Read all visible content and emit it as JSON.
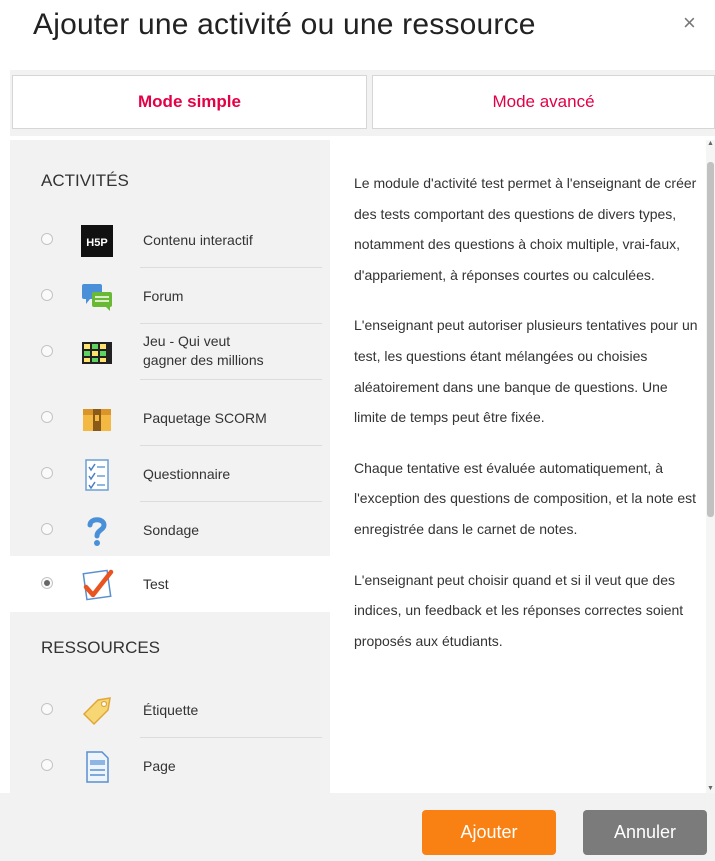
{
  "dialog": {
    "title": "Ajouter une activité ou une ressource",
    "close": "×"
  },
  "tabs": {
    "simple": "Mode simple",
    "advanced": "Mode avancé"
  },
  "sections": {
    "activities": "ACTIVITÉS",
    "resources": "RESSOURCES"
  },
  "activities": [
    {
      "label": "Contenu interactif",
      "icon": "h5p-icon",
      "selected": false
    },
    {
      "label": "Forum",
      "icon": "forum-icon",
      "selected": false
    },
    {
      "label_lines": [
        "Jeu - Qui veut",
        "gagner des millions"
      ],
      "icon": "game-icon",
      "selected": false
    },
    {
      "label": "Paquetage SCORM",
      "icon": "scorm-package-icon",
      "selected": false
    },
    {
      "label": "Questionnaire",
      "icon": "questionnaire-icon",
      "selected": false
    },
    {
      "label": "Sondage",
      "icon": "question-mark-icon",
      "selected": false
    },
    {
      "label": "Test",
      "icon": "quiz-check-icon",
      "selected": true
    }
  ],
  "resources": [
    {
      "label": "Étiquette",
      "icon": "tag-icon",
      "selected": false
    },
    {
      "label": "Page",
      "icon": "page-icon",
      "selected": false
    }
  ],
  "h5p_logo_text": "H5P",
  "description": [
    "Le module d'activité test permet à l'enseignant de créer des tests comportant des questions de divers types, notamment des questions à choix multiple, vrai-faux, d'appariement, à réponses courtes ou calculées.",
    "L'enseignant peut autoriser plusieurs tentatives pour un test, les questions étant mélangées ou choisies aléatoirement dans une banque de questions. Une limite de temps peut être fixée.",
    "Chaque tentative est évaluée automatiquement, à l'exception des questions de composition, et la note est enregistrée dans le carnet de notes.",
    "L'enseignant peut choisir quand et si il veut que des indices, un feedback et les réponses correctes soient proposés aux étudiants."
  ],
  "footer": {
    "add": "Ajouter",
    "cancel": "Annuler"
  },
  "colors": {
    "accent": "#e40046",
    "add_button": "#f98012",
    "cancel_button": "#7b7b7b"
  }
}
